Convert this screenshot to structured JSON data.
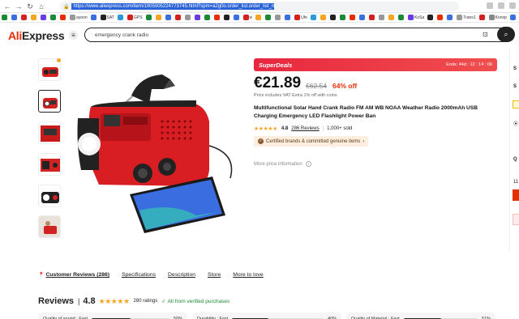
{
  "browser": {
    "url": "https://www.aliexpress.com/item/1005005224773745.html?spm=a2g0o.order_list.order_list_main.80.6c311802p39yo9",
    "bookmarks": [
      "",
      "",
      "",
      "",
      "",
      "",
      "",
      "ayoon",
      "",
      "SAT",
      "",
      "GPS",
      "",
      "",
      "",
      "",
      "",
      "",
      "",
      "",
      "",
      "",
      "w",
      "",
      "",
      "",
      "",
      "Ufe",
      "",
      "",
      "",
      "",
      "",
      "",
      "",
      "",
      "",
      "",
      "KoSa",
      "",
      "",
      "",
      "Trans1",
      "",
      "Konsp",
      "",
      "Paciwe"
    ]
  },
  "header": {
    "logo_ali": "Ali",
    "logo_express": "Express",
    "search_value": "emergency crank radio"
  },
  "deal": {
    "title": "SuperDeals",
    "ends": "Ends: 44d : 12 : 14 : 06"
  },
  "price": {
    "current": "€21.89",
    "original": "€62.54",
    "discount": "64% off",
    "note": "Price includes VAT Extra 1% off with coins"
  },
  "product": {
    "title": "Multifunctional Solar Hand Crank Radio FM AM WB NOAA Weather Radio 2000mAh USB Charging Emergency LED Flashlight Power Ban",
    "rating": "4.8",
    "reviews_link": "286 Reviews",
    "sold": "1,000+ sold",
    "certified": "Certified brands & committed genuine items",
    "more_info": "More price information"
  },
  "right_panel": {
    "s1": "S",
    "s2": "S",
    "q": "Q",
    "n": "11"
  },
  "tabs": [
    "Customer Reviews (286)",
    "Specifications",
    "Description",
    "Store",
    "More to love"
  ],
  "reviews": {
    "title": "Reviews",
    "score": "4.8",
    "ratings": "280 ratings",
    "verified": "All from verified purchases",
    "cards": [
      {
        "label": "Quality of sound : Fast",
        "pct": "50%",
        "fill": 50
      },
      {
        "label": "Durability : Fast",
        "pct": "40%",
        "fill": 40
      },
      {
        "label": "Quality of Material : Fast",
        "pct": "51%",
        "fill": 51
      }
    ]
  },
  "colors": {
    "accent": "#e62e04",
    "deal_red": "#e8273f",
    "star": "#f5a623",
    "verified": "#1a8a36"
  }
}
